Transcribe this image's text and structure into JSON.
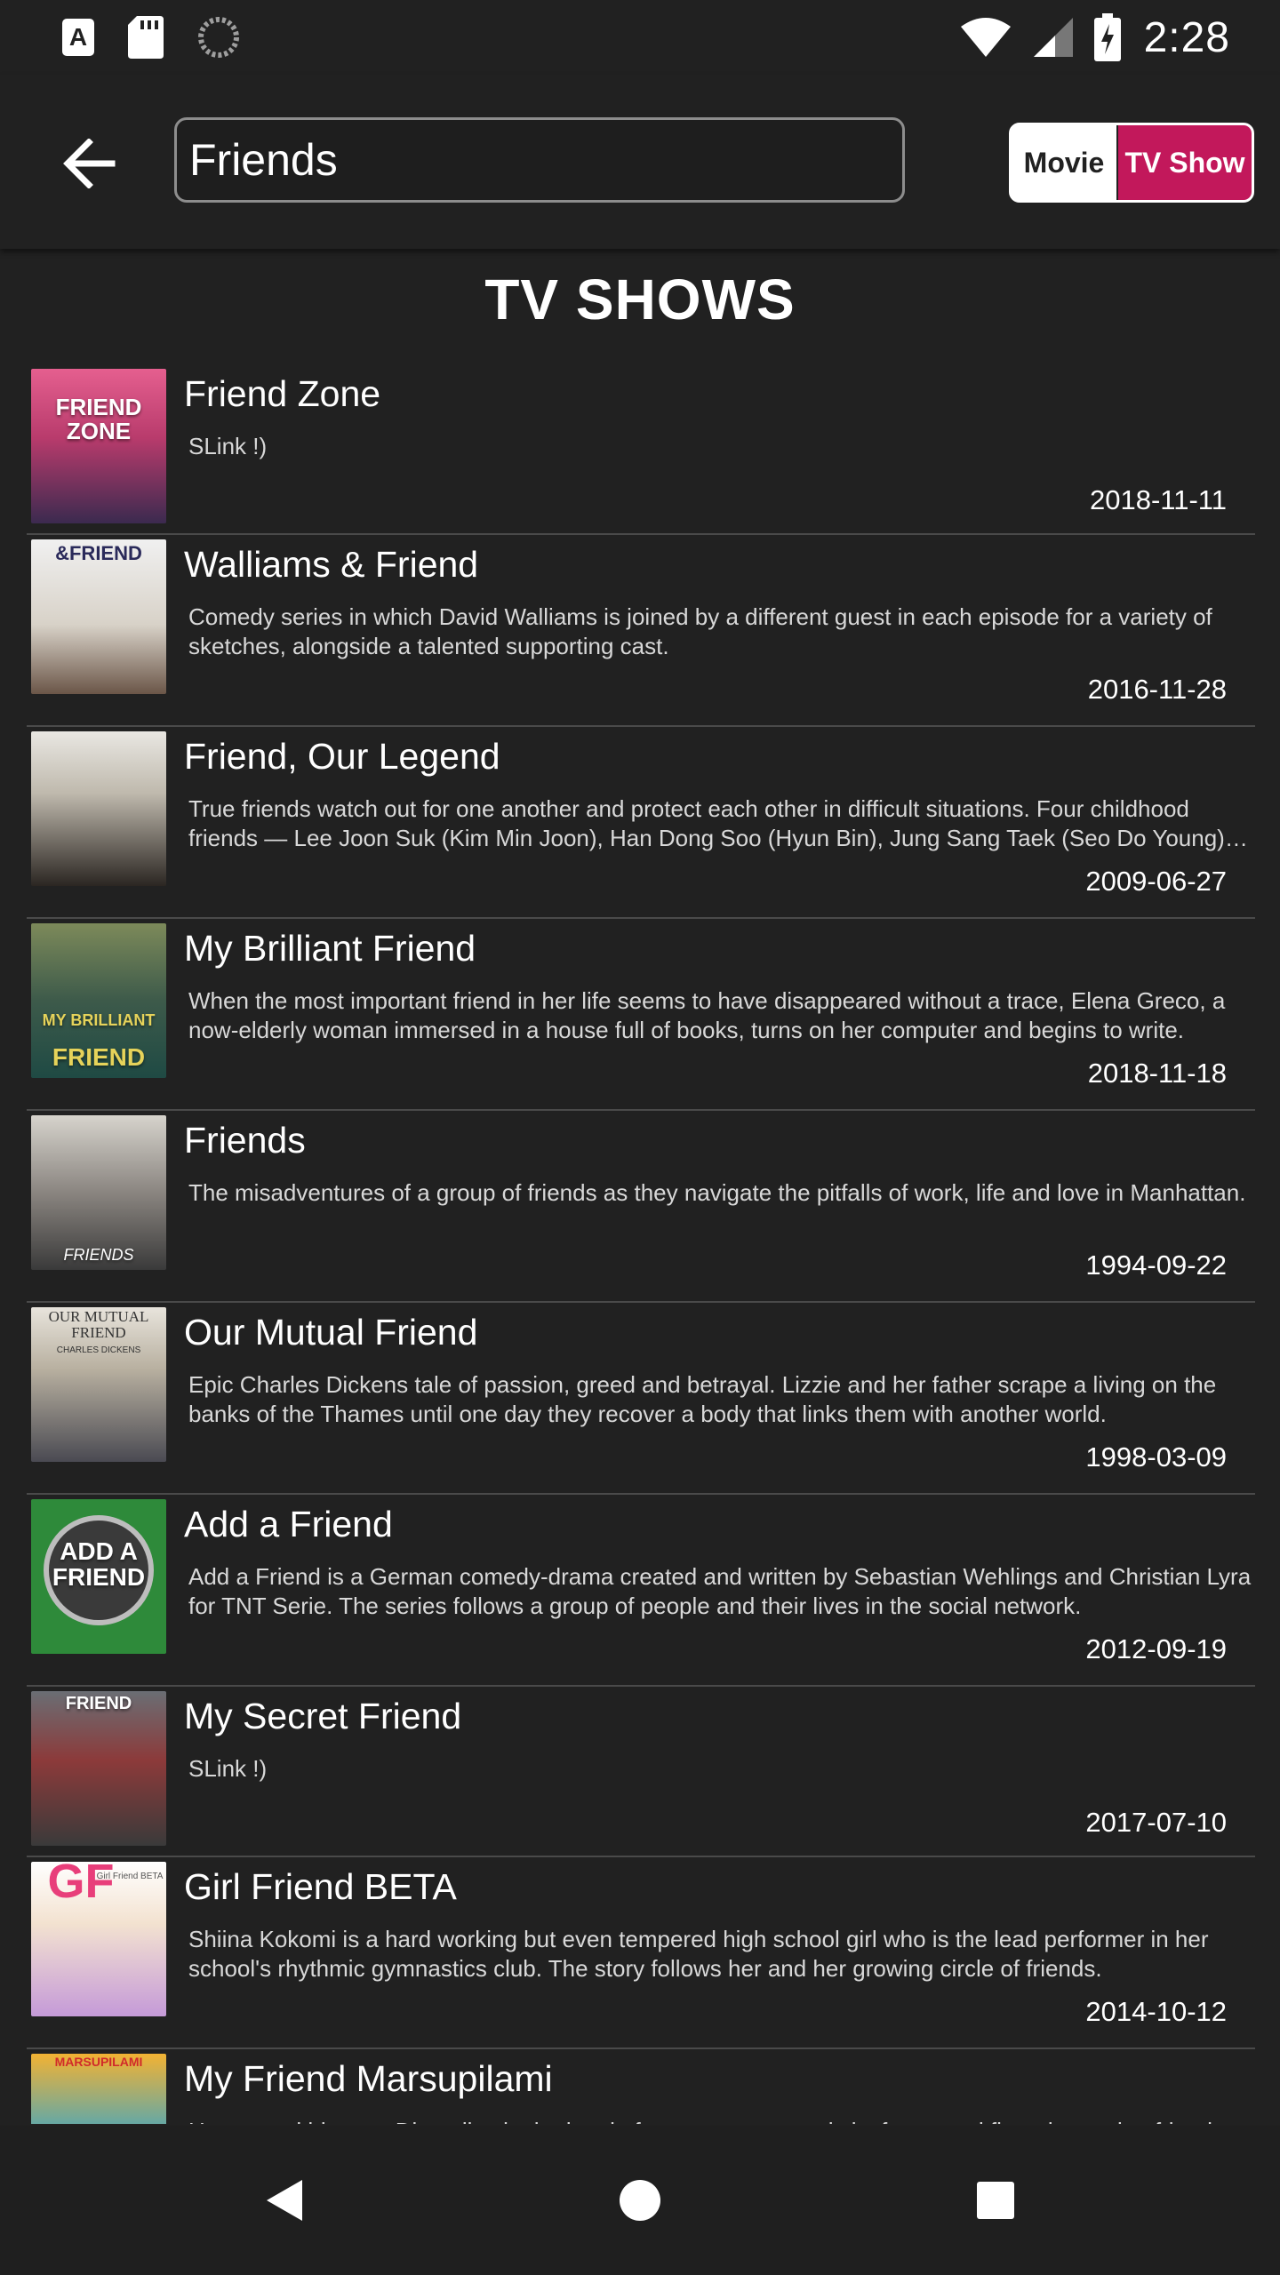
{
  "status_bar": {
    "time": "2:28",
    "icons": [
      "a-notification-icon",
      "sd-card-icon",
      "sync-icon",
      "wifi-icon",
      "signal-icon",
      "battery-charging-icon"
    ]
  },
  "search": {
    "query": "Friends",
    "placeholder": ""
  },
  "toggle": {
    "movie_label": "Movie",
    "tv_label": "TV Show",
    "selected": "TV Show",
    "accent": "#c2185b"
  },
  "section_title": "TV SHOWS",
  "shows": [
    {
      "title": "Friend Zone",
      "description": "SLink !)",
      "date": "2018-11-11"
    },
    {
      "title": "Walliams & Friend",
      "description": "Comedy series in which David Walliams is joined by a different guest in each episode for a variety of sketches, alongside a talented supporting cast.",
      "date": "2016-11-28"
    },
    {
      "title": "Friend, Our Legend",
      "description": "True friends watch out for one another and protect each other in difficult situations. Four childhood friends — Lee Joon Suk (Kim Min Joon), Han Dong Soo (Hyun Bin), Jung Sang Taek (Seo Do Young) and Do Sung Hoon (Wang Ji Hye) share a bond.",
      "date": "2009-06-27"
    },
    {
      "title": "My Brilliant Friend",
      "description": "When the most important friend in her life seems to have disappeared without a trace, Elena Greco, a now-elderly woman immersed in a house full of books, turns on her computer and begins to write.",
      "date": "2018-11-18"
    },
    {
      "title": "Friends",
      "description": "The misadventures of a group of friends as they navigate the pitfalls of work, life and love in Manhattan.",
      "date": "1994-09-22"
    },
    {
      "title": "Our Mutual Friend",
      "description": "Epic Charles Dickens tale of passion, greed and betrayal. Lizzie and her father scrape a living on the banks of the Thames until one day they recover a body that links them with another world.",
      "date": "1998-03-09"
    },
    {
      "title": "Add a Friend",
      "description": "Add a Friend is a German comedy-drama created and written by Sebastian Wehlings and Christian Lyra for TNT Serie. The series follows a group of people and their lives in the social network.",
      "date": "2012-09-19"
    },
    {
      "title": "My Secret Friend",
      "description": "SLink !)",
      "date": "2017-07-10"
    },
    {
      "title": "Girl Friend BETA",
      "description": "Shiina Kokomi is a hard working but even tempered high school girl who is the lead performer in her school's rhythmic gymnastics club. The story follows her and her growing circle of friends.",
      "date": "2014-10-12"
    },
    {
      "title": "My Friend Marsupilami",
      "description": "Hector and his aunt Diane live in the jungle for one year to study its fauna and flora, becoming friends with the Marsupilami.",
      "date": ""
    }
  ],
  "posters": [
    {
      "text": "FRIEND ZONE",
      "sub": ""
    },
    {
      "text": "&FRIEND",
      "sub": ""
    },
    {
      "text": "",
      "sub": ""
    },
    {
      "text": "MY BRILLIANT",
      "sub": "FRIEND"
    },
    {
      "text": "",
      "sub": "FRIENDS"
    },
    {
      "text": "OUR MUTUAL FRIEND",
      "sub": "CHARLES DICKENS"
    },
    {
      "text": "ADD A FRIEND",
      "sub": ""
    },
    {
      "text": "FRIEND",
      "sub": ""
    },
    {
      "text": "GF",
      "sub": "Girl Friend BETA"
    },
    {
      "text": "MARSUPILAMI",
      "sub": ""
    }
  ],
  "nav": {
    "back": "nav-back-icon",
    "home": "nav-home-icon",
    "recents": "nav-recents-icon"
  }
}
